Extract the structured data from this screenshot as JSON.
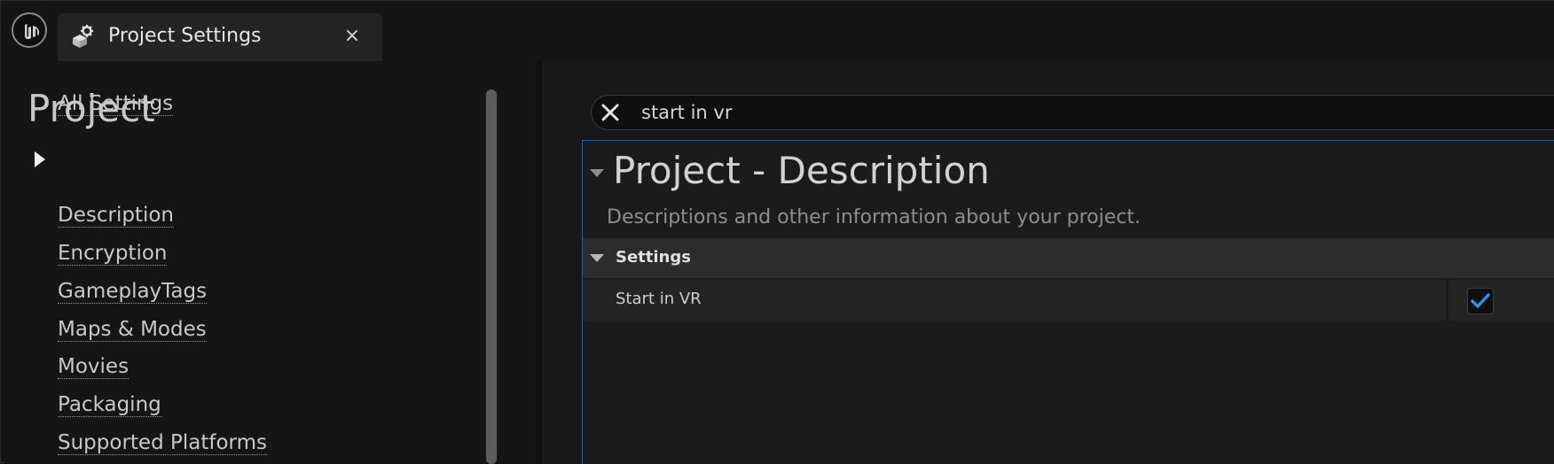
{
  "tab": {
    "title": "Project Settings",
    "icon": "settings-gear-cube-icon",
    "close_glyph": "×"
  },
  "nav": {
    "all_settings": "All Settings",
    "section_title": "Project",
    "items": [
      {
        "label": "Description",
        "selected": true
      },
      {
        "label": "Encryption"
      },
      {
        "label": "GameplayTags"
      },
      {
        "label": "Maps & Modes"
      },
      {
        "label": "Movies"
      },
      {
        "label": "Packaging"
      },
      {
        "label": "Supported Platforms"
      }
    ]
  },
  "search": {
    "value": "start in vr"
  },
  "panel": {
    "title": "Project - Description",
    "description": "Descriptions and other information about your project.",
    "group": {
      "label": "Settings",
      "properties": [
        {
          "label": "Start in VR",
          "checked": true
        }
      ]
    }
  },
  "colors": {
    "accent": "#1e5fa8",
    "check": "#2f8ff0",
    "background": "#151515"
  }
}
